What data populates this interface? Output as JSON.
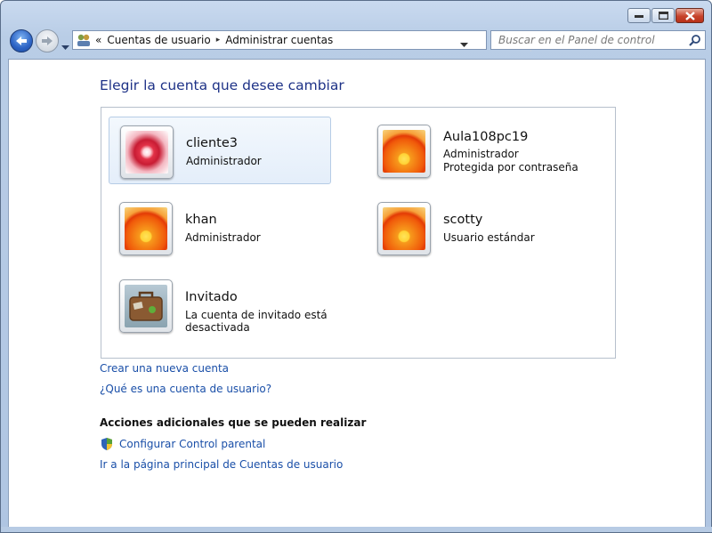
{
  "window": {
    "caption_buttons": [
      {
        "name": "minimize-button"
      },
      {
        "name": "maximize-button"
      },
      {
        "name": "close-button"
      }
    ]
  },
  "toolbar": {
    "breadcrumb_overflow": "«",
    "breadcrumb": [
      "Cuentas de usuario",
      "Administrar cuentas"
    ],
    "separator": "▸",
    "search_placeholder": "Buscar en el Panel de control"
  },
  "main": {
    "heading": "Elegir la cuenta que desee cambiar",
    "accounts": [
      {
        "name": "cliente3",
        "lines": [
          "Administrador"
        ],
        "picture": "star-flower",
        "selected": true
      },
      {
        "name": "Aula108pc19",
        "lines": [
          "Administrador",
          "Protegida por contraseña"
        ],
        "picture": "orange-flower"
      },
      {
        "name": "khan",
        "lines": [
          "Administrador"
        ],
        "picture": "orange-flower"
      },
      {
        "name": "scotty",
        "lines": [
          "Usuario estándar"
        ],
        "picture": "orange-flower"
      },
      {
        "name": "Invitado",
        "lines": [
          "La cuenta de invitado está desactivada"
        ],
        "picture": "suitcase"
      }
    ],
    "links": {
      "create": "Crear una nueva cuenta",
      "what_is": "¿Qué es una cuenta de usuario?"
    },
    "additional": {
      "title": "Acciones adicionales que se pueden realizar",
      "parental": "Configurar Control parental",
      "home": "Ir a la página principal de Cuentas de usuario"
    }
  },
  "colors": {
    "heading": "#1e3287",
    "link": "#1a4fa8",
    "selection_bg": "#e4eefa"
  }
}
